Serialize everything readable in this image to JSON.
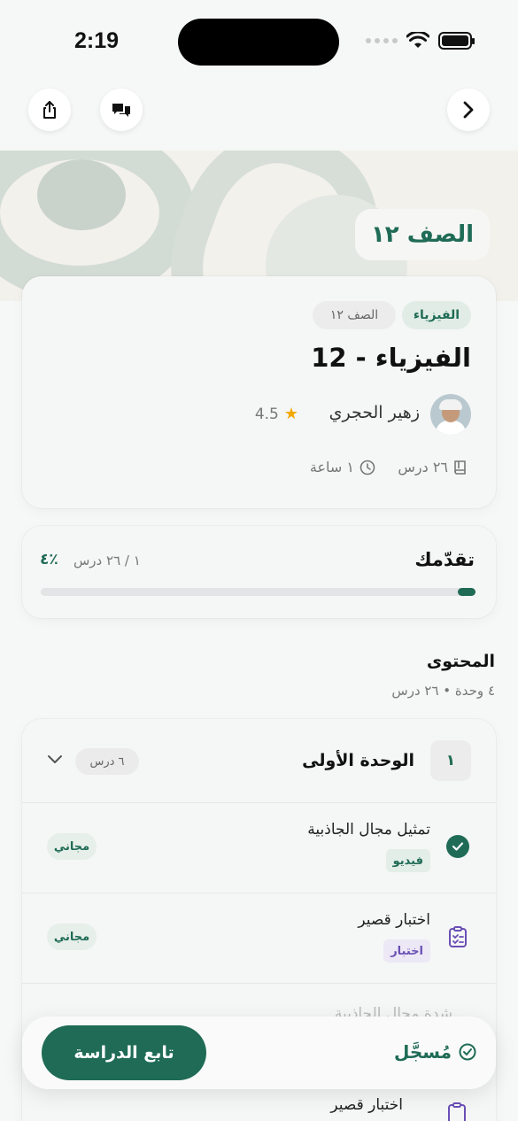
{
  "status_bar": {
    "time": "2:19"
  },
  "header": {
    "grade_label": "الصف ١٢"
  },
  "course": {
    "subject_tag": "الفيزياء",
    "grade_tag": "الصف ١٢",
    "title": "الفيزياء - 12",
    "teacher": "زهير الحجري",
    "rating": "4.5",
    "lessons": "٢٦ درس",
    "hours": "١ ساعة"
  },
  "progress": {
    "title": "تقدّمك",
    "count": "١ / ٢٦ درس",
    "percent_label": "٤٪",
    "percent_value": 4
  },
  "content": {
    "title": "المحتوى",
    "subtitle": "٤ وحدة • ٢٦ درس"
  },
  "unit": {
    "number": "١",
    "title": "الوحدة الأولى",
    "count": "٦ درس",
    "lessons": [
      {
        "title": "تمثيل مجال الجاذبية",
        "type": "فيديو",
        "badge": "مجاني"
      },
      {
        "title": "اختبار قصير",
        "type": "اختبار",
        "badge": "مجاني"
      }
    ],
    "faded_title": "شدة مجال الجاذبية",
    "next_title": "اختبار قصير"
  },
  "bottom_bar": {
    "enrolled": "مُسجَّل",
    "continue": "تابع الدراسة"
  },
  "colors": {
    "accent": "#1f6b56",
    "quiz": "#6a4fb5"
  }
}
